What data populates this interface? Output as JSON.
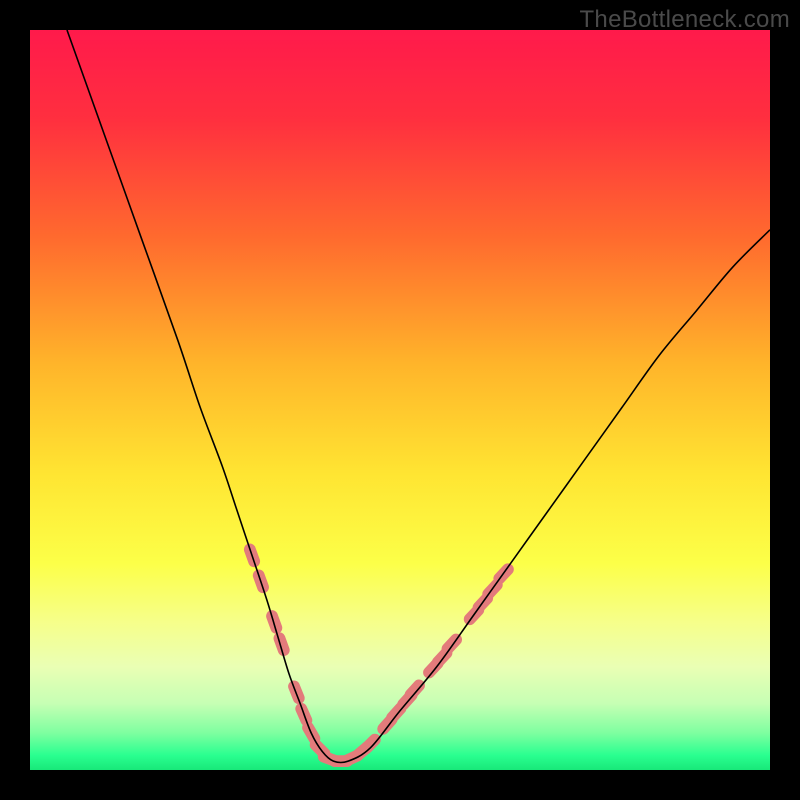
{
  "watermark": "TheBottleneck.com",
  "gradient_stops": [
    {
      "offset": 0.0,
      "color": "#ff1a4b"
    },
    {
      "offset": 0.12,
      "color": "#ff2f3f"
    },
    {
      "offset": 0.28,
      "color": "#ff6a2e"
    },
    {
      "offset": 0.45,
      "color": "#ffb42a"
    },
    {
      "offset": 0.6,
      "color": "#ffe532"
    },
    {
      "offset": 0.72,
      "color": "#fcff48"
    },
    {
      "offset": 0.8,
      "color": "#f6ff8a"
    },
    {
      "offset": 0.86,
      "color": "#eaffb4"
    },
    {
      "offset": 0.91,
      "color": "#c6ffb4"
    },
    {
      "offset": 0.95,
      "color": "#7effa0"
    },
    {
      "offset": 0.98,
      "color": "#2aff90"
    },
    {
      "offset": 1.0,
      "color": "#18e879"
    }
  ],
  "chart_data": {
    "type": "line",
    "title": "",
    "xlabel": "",
    "ylabel": "",
    "xlim": [
      0,
      100
    ],
    "ylim": [
      0,
      100
    ],
    "series": [
      {
        "name": "bottleneck-curve",
        "stroke": "#000000",
        "stroke_width": 1.6,
        "x": [
          5,
          10,
          15,
          20,
          23,
          26,
          28,
          30,
          32,
          33.5,
          35,
          36.5,
          38,
          39.5,
          41,
          43,
          46,
          50,
          55,
          60,
          65,
          70,
          75,
          80,
          85,
          90,
          95,
          100
        ],
        "y": [
          100,
          86,
          72,
          58,
          49,
          41,
          35,
          29,
          23,
          18,
          13,
          9,
          5,
          2.5,
          1.2,
          1.2,
          3,
          8,
          14,
          21,
          28,
          35,
          42,
          49,
          56,
          62,
          68,
          73
        ]
      }
    ],
    "markers": [
      {
        "name": "highlight-capsules",
        "fill": "#e37b7b",
        "shape": "capsule",
        "cap_w": 3.3,
        "cap_h": 1.6,
        "points": [
          {
            "x": 30.0,
            "y": 29.0,
            "angle": -70
          },
          {
            "x": 31.2,
            "y": 25.5,
            "angle": -70
          },
          {
            "x": 33.0,
            "y": 20.0,
            "angle": -70
          },
          {
            "x": 34.0,
            "y": 17.0,
            "angle": -70
          },
          {
            "x": 36.0,
            "y": 10.5,
            "angle": -68
          },
          {
            "x": 37.0,
            "y": 7.5,
            "angle": -66
          },
          {
            "x": 38.0,
            "y": 5.0,
            "angle": -60
          },
          {
            "x": 39.2,
            "y": 2.8,
            "angle": -45
          },
          {
            "x": 40.5,
            "y": 1.5,
            "angle": -20
          },
          {
            "x": 42.0,
            "y": 1.2,
            "angle": 0
          },
          {
            "x": 43.5,
            "y": 1.6,
            "angle": 25
          },
          {
            "x": 45.0,
            "y": 2.6,
            "angle": 40
          },
          {
            "x": 46.0,
            "y": 3.5,
            "angle": 45
          },
          {
            "x": 48.3,
            "y": 6.2,
            "angle": 48
          },
          {
            "x": 49.5,
            "y": 7.7,
            "angle": 48
          },
          {
            "x": 51.0,
            "y": 9.5,
            "angle": 48
          },
          {
            "x": 52.0,
            "y": 10.8,
            "angle": 48
          },
          {
            "x": 54.5,
            "y": 13.8,
            "angle": 47
          },
          {
            "x": 55.7,
            "y": 15.2,
            "angle": 47
          },
          {
            "x": 57.0,
            "y": 17.0,
            "angle": 47
          },
          {
            "x": 60.0,
            "y": 21.0,
            "angle": 47
          },
          {
            "x": 61.2,
            "y": 22.6,
            "angle": 47
          },
          {
            "x": 62.5,
            "y": 24.4,
            "angle": 47
          },
          {
            "x": 64.0,
            "y": 26.5,
            "angle": 47
          }
        ]
      }
    ]
  }
}
